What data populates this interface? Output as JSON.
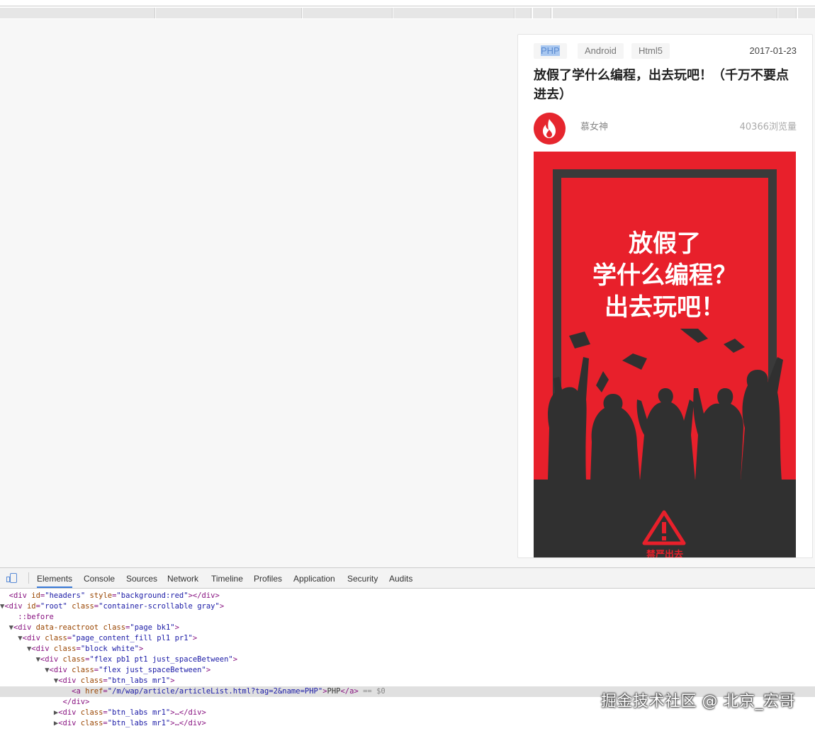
{
  "article": {
    "tags": [
      "PHP",
      "Android",
      "Html5"
    ],
    "date": "2017-01-23",
    "title": "放假了学什么编程，出去玩吧！（千万不要点进去）",
    "author": "慕女神",
    "views": "40366浏览量",
    "poster": {
      "line1": "放假了",
      "line2": "学什么编程？",
      "line3": "出去玩吧！",
      "warning": "禁严出去"
    }
  },
  "devtools": {
    "tabs": [
      "Elements",
      "Console",
      "Sources",
      "Network",
      "Timeline",
      "Profiles",
      "Application",
      "Security",
      "Audits"
    ],
    "active_tab": "Elements",
    "lines": [
      {
        "indent": "",
        "arrow": "",
        "html": "headers"
      },
      {
        "indent": "",
        "arrow": "▼",
        "html": "root"
      }
    ]
  },
  "watermark": "掘金技术社区 @ 北京_宏哥",
  "colors": {
    "accent": "#e8202b",
    "selected_tag": "#a8c7f0",
    "devtools_active": "#3879d9"
  }
}
